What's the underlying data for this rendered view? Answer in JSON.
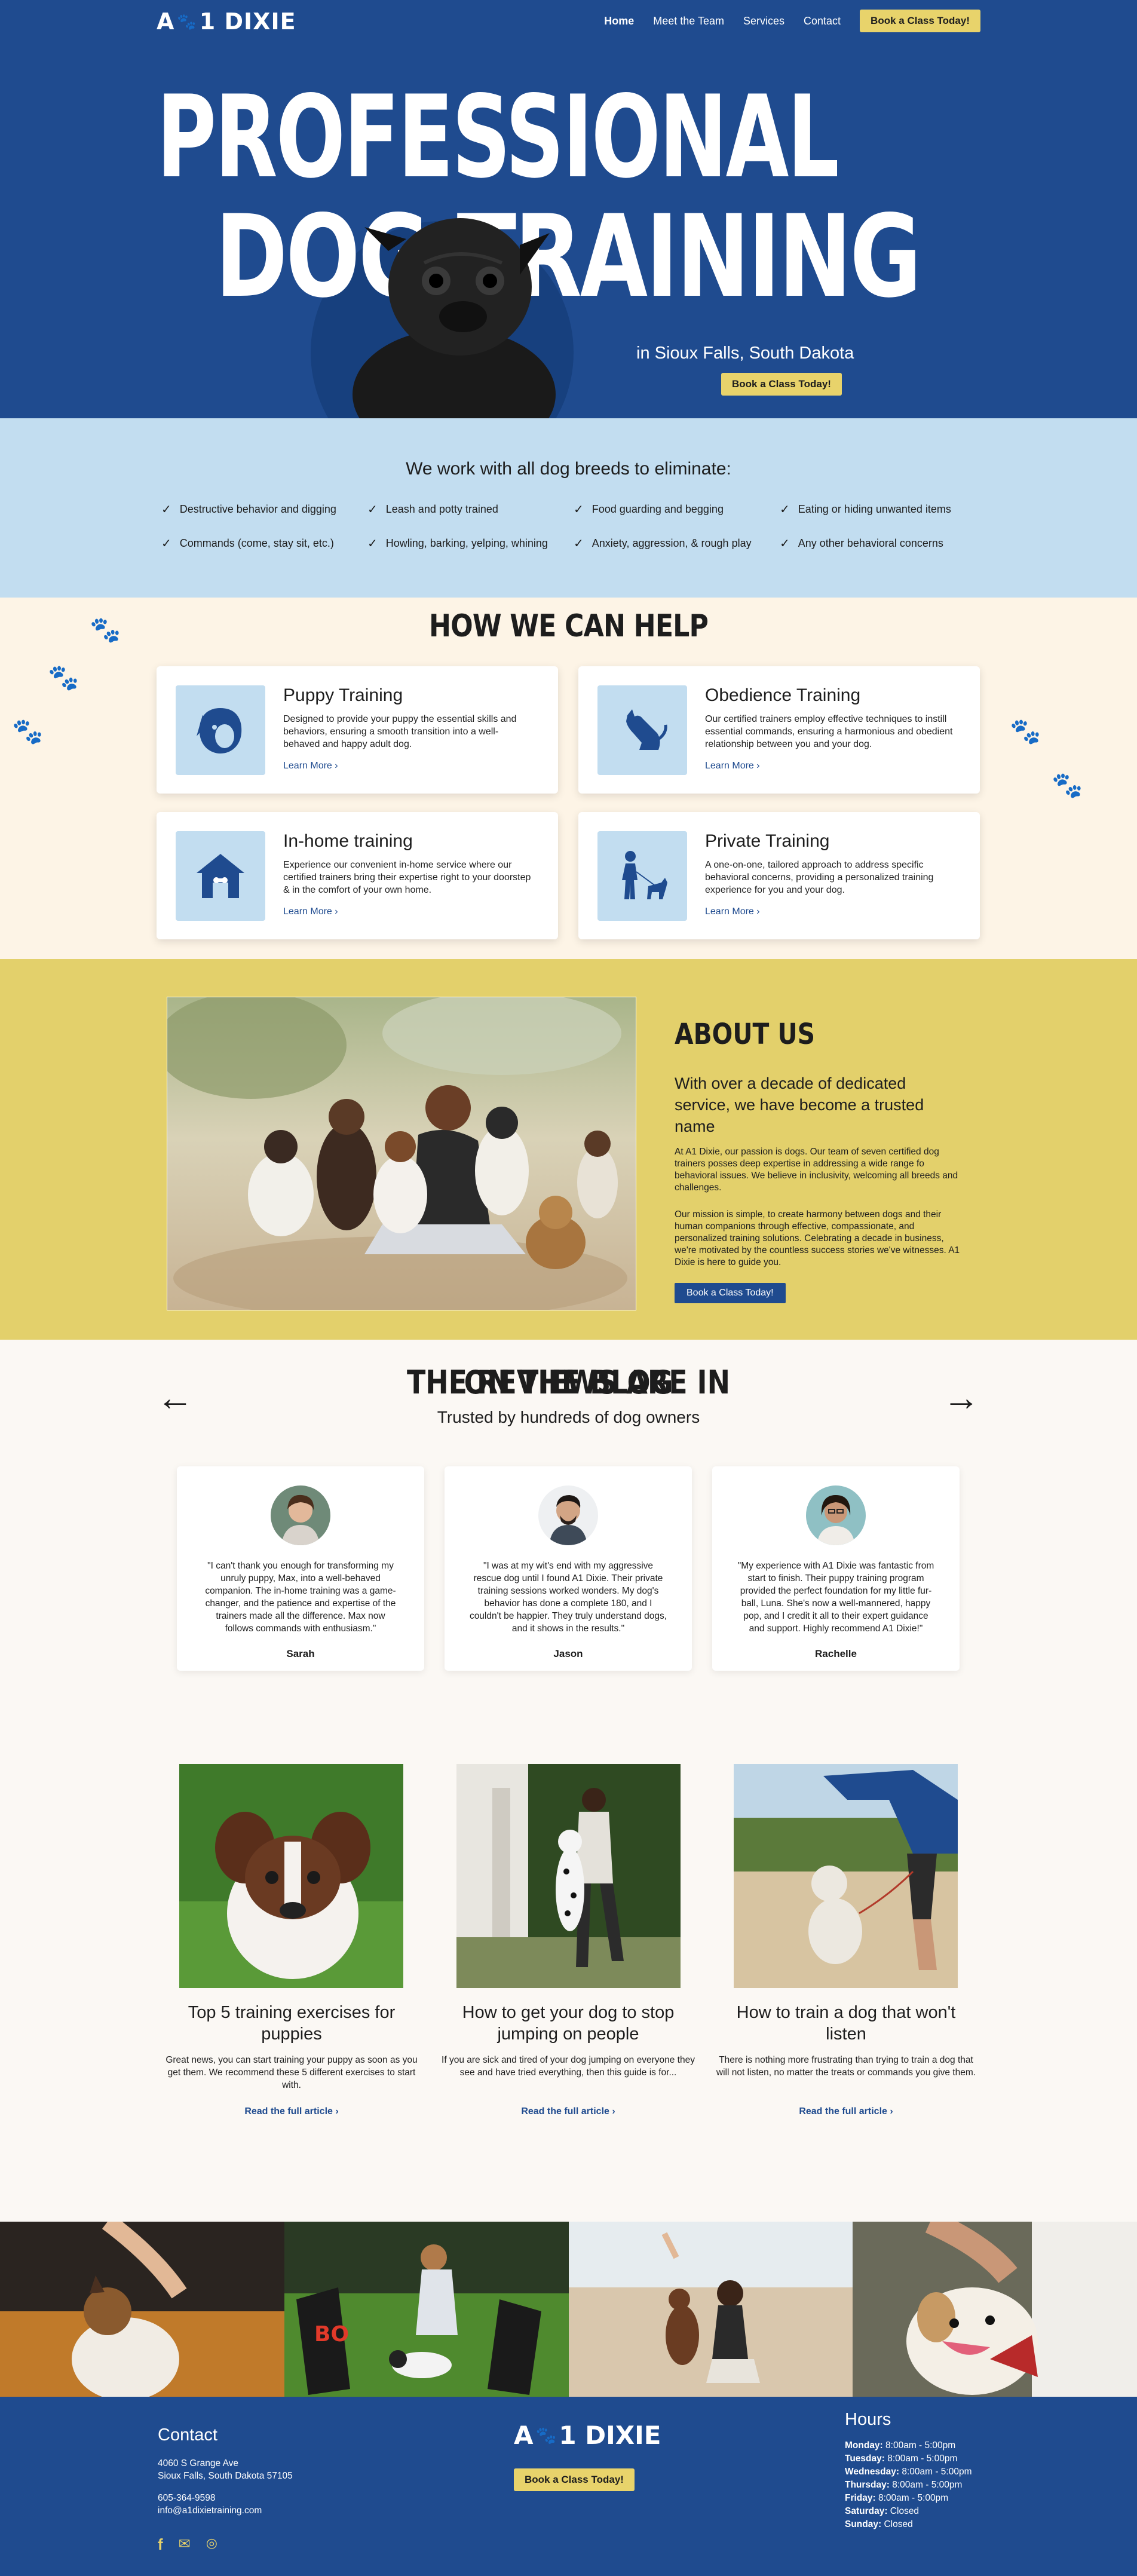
{
  "brand": {
    "name_left": "A",
    "name_right": "1 DIXIE",
    "paw": "🐾"
  },
  "nav": {
    "items": [
      "Home",
      "Meet the Team",
      "Services",
      "Contact"
    ],
    "cta": "Book a Class Today!"
  },
  "hero": {
    "line1": "PROFESSIONAL",
    "line2": "DOG TRAINING",
    "subtitle": "in Sioux Falls, South Dakota",
    "cta": "Book a Class Today!"
  },
  "breeds": {
    "heading": "We work with all dog breeds to eliminate:",
    "items": [
      "Destructive behavior and digging",
      "Leash and potty trained",
      "Food guarding and begging",
      "Eating or hiding unwanted items",
      "Commands (come, stay sit, etc.)",
      "Howling, barking, yelping, whining",
      "Anxiety, aggression, & rough play",
      "Any other behavioral concerns"
    ]
  },
  "help": {
    "heading": "HOW WE CAN HELP",
    "cards": [
      {
        "title": "Puppy Training",
        "text": "Designed to provide your puppy the essential skills and behaviors, ensuring a smooth transition into a well-behaved and happy adult dog.",
        "more": "Learn More ›"
      },
      {
        "title": "Obedience Training",
        "text": "Our certified trainers employ effective techniques to instill essential commands, ensuring a harmonious and obedient relationship between you and your dog.",
        "more": "Learn More ›"
      },
      {
        "title": "In-home training",
        "text": "Experience our convenient in-home service where our certified trainers bring their expertise right to your doorstep & in the comfort of your own home.",
        "more": "Learn More ›"
      },
      {
        "title": "Private Training",
        "text": "A one-on-one, tailored approach to address specific behavioral concerns, providing a personalized training experience for you and your dog.",
        "more": "Learn More ›"
      }
    ]
  },
  "about": {
    "heading": "ABOUT US",
    "lead": "With over a decade of dedicated service, we have become a trusted name",
    "p1": "At A1 Dixie, our passion is dogs. Our team of seven certified dog trainers posses deep expertise in addressing a wide range fo behavioral issues. We believe in inclusivity, welcoming all breeds and challenges.",
    "p2": "Our mission is simple, to create harmony between dogs and their human companions through effective, compassionate, and personalized training solutions. Celebrating a decade in business, we're motivated by the countless success stories we've witnesses. A1 Dixie is here to guide you.",
    "cta": "Book a Class Today!"
  },
  "reviews": {
    "heading": "THE REVIEWS ARE IN",
    "subtitle": "Trusted by hundreds of dog owners",
    "prev": "←",
    "next": "→",
    "items": [
      {
        "text": "\"I can't thank you enough for transforming my unruly puppy, Max, into a well-behaved companion. The in-home training was a game-changer, and the patience and expertise of the trainers made all the difference. Max now follows commands with enthusiasm.\"",
        "name": "Sarah"
      },
      {
        "text": "\"I was at my wit's end with my aggressive rescue dog until I found A1 Dixie. Their private training sessions worked wonders. My dog's behavior has done a complete 180, and I couldn't be happier. They truly understand dogs, and it shows in the results.\"",
        "name": "Jason"
      },
      {
        "text": "\"My experience with A1 Dixie was fantastic from start to finish. Their puppy training program provided the perfect foundation for my little fur-ball, Luna. She's now a well-mannered, happy pop, and I credit it all to their expert guidance and support. Highly recommend A1 Dixie!\"",
        "name": "Rachelle"
      }
    ]
  },
  "blog": {
    "heading": "ON THE BLOG",
    "posts": [
      {
        "title": "Top 5 training exercises for puppies",
        "text": "Great news, you can start training your puppy as soon as you get them. We recommend these 5 different exercises to start with.",
        "link": "Read the full article ›"
      },
      {
        "title": "How to get your dog to stop jumping on people",
        "text": "If you are sick and tired of your dog jumping on everyone they see and have tried everything, then this guide is for...",
        "link": "Read the full article ›"
      },
      {
        "title": "How to train a dog that won't listen",
        "text": "There is nothing more frustrating than trying to train a dog that will not listen, no matter the treats or commands you give them.",
        "link": "Read the full article ›"
      }
    ]
  },
  "footer": {
    "contact_heading": "Contact",
    "address1": "4060 S Grange Ave",
    "address2": "Sioux Falls, South Dakota 57105",
    "phone": "605-364-9598",
    "email": "info@a1dixietraining.com",
    "cta": "Book a Class Today!",
    "hours_heading": "Hours",
    "hours": [
      {
        "day": "Monday:",
        "time": " 8:00am - 5:00pm"
      },
      {
        "day": "Tuesday:",
        "time": " 8:00am - 5:00pm"
      },
      {
        "day": "Wednesday:",
        "time": " 8:00am - 5:00pm"
      },
      {
        "day": "Thursday:",
        "time": " 8:00am - 5:00pm"
      },
      {
        "day": "Friday:",
        "time": " 8:00am - 5:00pm"
      },
      {
        "day": "Saturday:",
        "time": " Closed"
      },
      {
        "day": "Sunday:",
        "time": " Closed"
      }
    ]
  },
  "colors": {
    "blue": "#1f4b8f",
    "yellow": "#e8d36b",
    "light_blue": "#c2ddf0",
    "cream": "#fdf4e6",
    "mustard": "#e3d06b"
  }
}
